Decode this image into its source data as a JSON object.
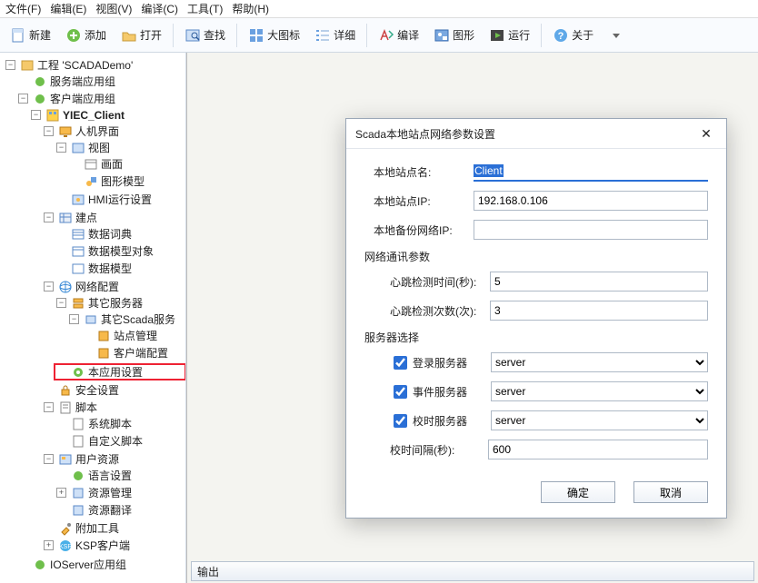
{
  "menu": {
    "file": "文件(F)",
    "edit": "编辑(E)",
    "view": "视图(V)",
    "compile": "编译(C)",
    "tools": "工具(T)",
    "help": "帮助(H)"
  },
  "toolbar": {
    "new": "新建",
    "add": "添加",
    "open": "打开",
    "find": "查找",
    "large_icon": "大图标",
    "detail": "详细",
    "compile": "编译",
    "graphic": "图形",
    "run": "运行",
    "about": "关于"
  },
  "tree": {
    "project": "工程 'SCADADemo'",
    "server_app_group": "服务端应用组",
    "client_app_group": "客户端应用组",
    "yiec_client": "YIEC_Client",
    "hmi": "人机界面",
    "view": "视图",
    "screen": "画面",
    "graphic_model": "图形模型",
    "hmi_run": "HMI运行设置",
    "build_point": "建点",
    "data_dict": "数据词典",
    "data_model_obj": "数据模型对象",
    "data_model": "数据模型",
    "net_config": "网络配置",
    "other_server": "其它服务器",
    "other_scada": "其它Scada服务",
    "site_mgmt": "站点管理",
    "client_cfg": "客户端配置",
    "this_app_setting": "本应用设置",
    "security": "安全设置",
    "script": "脚本",
    "sys_script": "系统脚本",
    "custom_script": "自定义脚本",
    "user_res": "用户资源",
    "lang_setting": "语言设置",
    "res_mgmt": "资源管理",
    "res_trans": "资源翻译",
    "addon_tools": "附加工具",
    "ksp_client": "KSP客户端",
    "ioserver_group": "IOServer应用组"
  },
  "output_header": "输出",
  "dialog": {
    "title": "Scada本地站点网络参数设置",
    "site_name_label": "本地站点名:",
    "site_name_value": "Client",
    "site_ip_label": "本地站点IP:",
    "site_ip_value": "192.168.0.106",
    "backup_ip_label": "本地备份网络IP:",
    "backup_ip_value": "",
    "net_params_label": "网络通讯参数",
    "heartbeat_time_label": "心跳检测时间(秒):",
    "heartbeat_time_value": "5",
    "heartbeat_count_label": "心跳检测次数(次):",
    "heartbeat_count_value": "3",
    "server_select_label": "服务器选择",
    "login_server_label": "登录服务器",
    "login_server_value": "server",
    "event_server_label": "事件服务器",
    "event_server_value": "server",
    "time_server_label": "校时服务器",
    "time_server_value": "server",
    "sync_interval_label": "校时间隔(秒):",
    "sync_interval_value": "600",
    "ok": "确定",
    "cancel": "取消"
  }
}
